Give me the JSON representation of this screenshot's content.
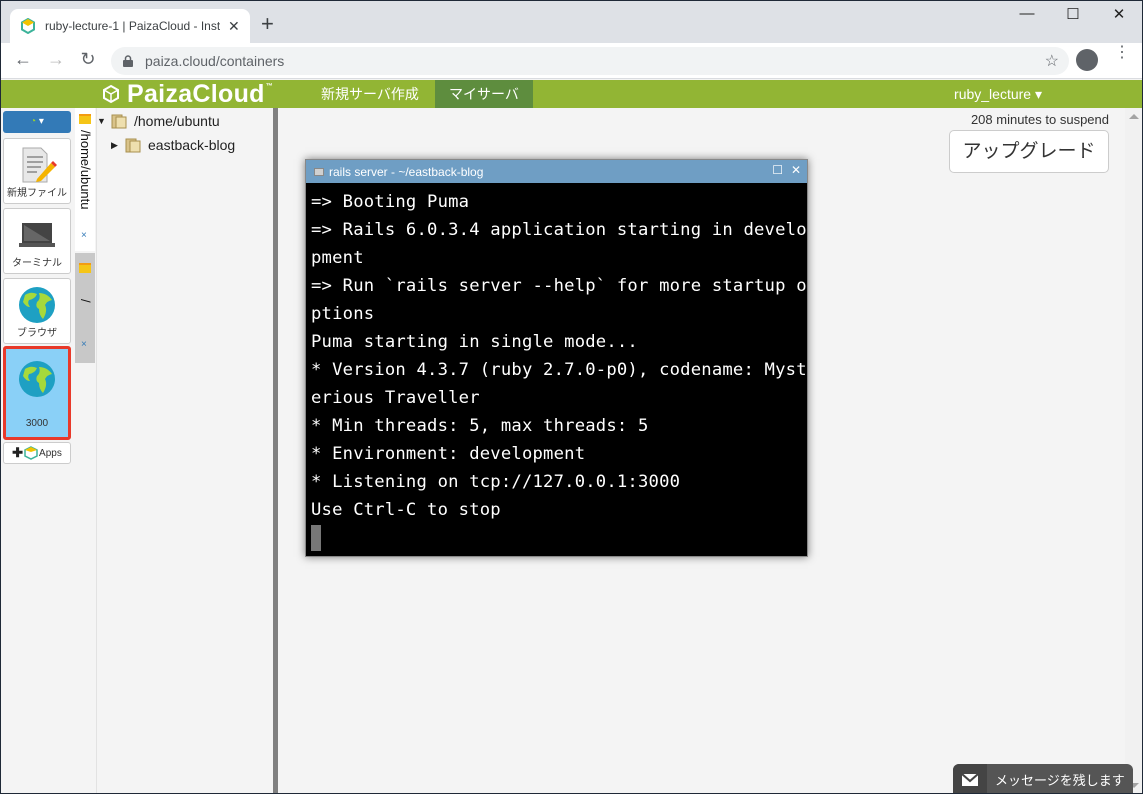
{
  "browser": {
    "tab_title": "ruby-lecture-1 | PaizaCloud - Inst",
    "tab_close": "✕",
    "new_tab": "+",
    "url": "paiza.cloud/containers",
    "minimize": "—",
    "maximize": "☐",
    "close": "✕",
    "back": "←",
    "forward": "→",
    "reload": "↻",
    "bookmark": "☆",
    "menu": "⋮"
  },
  "header": {
    "brand": "PaizaCloud",
    "trademark": "™",
    "nav": [
      {
        "label": "新規サーバ作成",
        "active": false
      },
      {
        "label": "マイサーバ",
        "active": true
      }
    ],
    "user": "ruby_lecture ▾",
    "accent_color": "#92b534",
    "active_nav_color": "#5e8d3e"
  },
  "appbar": {
    "dropdown_caret": "▾",
    "items": [
      {
        "label": "新規ファイル",
        "icon": "new-file-icon"
      },
      {
        "label": "ターミナル",
        "icon": "terminal-icon"
      },
      {
        "label": "ブラウザ",
        "icon": "globe-icon"
      },
      {
        "label": "3000",
        "icon": "globe-icon",
        "active": true
      }
    ],
    "add_apps": "Apps"
  },
  "folder_tabs": [
    {
      "label": "/home/ubuntu",
      "close": "×",
      "active": true
    },
    {
      "label": "/",
      "close": "×",
      "active": false
    }
  ],
  "tree": {
    "root": "/home/ubuntu",
    "children": [
      "eastback-blog"
    ]
  },
  "main": {
    "suspend_text": "208 minutes to suspend",
    "upgrade_label": "アップグレード"
  },
  "terminal": {
    "title": "rails server - ~/eastback-blog",
    "maximize": "☐",
    "close": "✕",
    "lines": [
      "=> Booting Puma",
      "=> Rails 6.0.3.4 application starting in develo",
      "pment",
      "=> Run `rails server --help` for more startup o",
      "ptions",
      "Puma starting in single mode...",
      "* Version 4.3.7 (ruby 2.7.0-p0), codename: Myst",
      "erious Traveller",
      "* Min threads: 5, max threads: 5",
      "* Environment: development",
      "* Listening on tcp://127.0.0.1:3000",
      "Use Ctrl-C to stop"
    ]
  },
  "message_widget": {
    "label": "メッセージを残します"
  }
}
